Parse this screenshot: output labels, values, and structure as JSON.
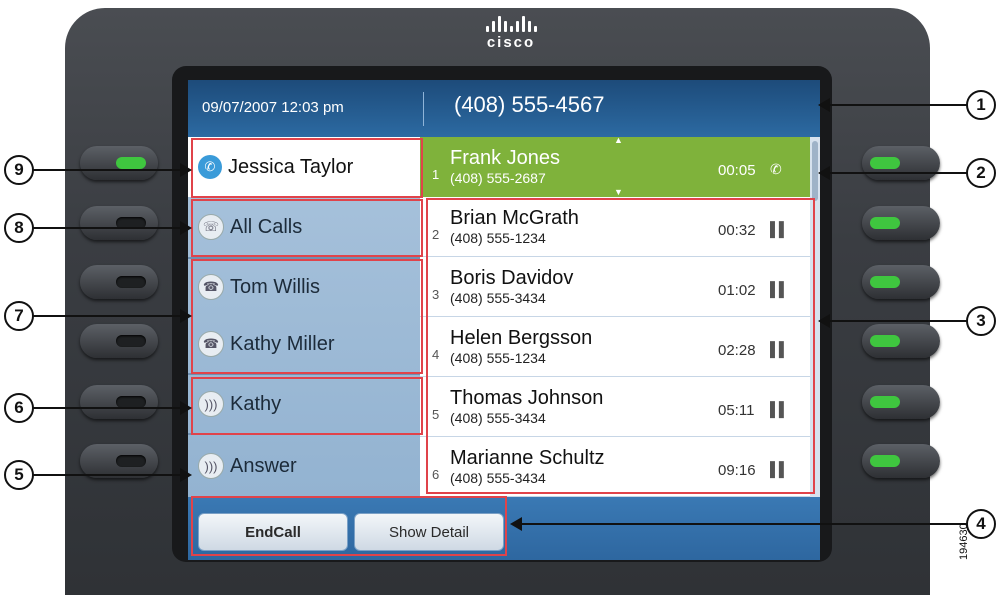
{
  "brand": {
    "logo_text": "cisco"
  },
  "header": {
    "datetime": "09/07/2007 12:03 pm",
    "phone_number": "(408) 555-4567"
  },
  "lines": [
    {
      "label": "Jessica Taylor",
      "icon": "phone-line-icon",
      "active": true
    },
    {
      "label": "All Calls",
      "icon": "all-calls-icon"
    },
    {
      "label": "Tom Willis",
      "icon": "handset-icon"
    },
    {
      "label": "Kathy Miller",
      "icon": "handset-icon"
    },
    {
      "label": "Kathy",
      "icon": "ringing-line-icon"
    },
    {
      "label": "Answer",
      "icon": "answer-icon"
    }
  ],
  "calls": [
    {
      "index": "1",
      "name": "Frank Jones",
      "number": "(408) 555-2687",
      "time": "00:05",
      "state": "active-call-icon"
    },
    {
      "index": "2",
      "name": "Brian McGrath",
      "number": "(408) 555-1234",
      "time": "00:32",
      "state": "hold-icon"
    },
    {
      "index": "3",
      "name": "Boris Davidov",
      "number": "(408) 555-3434",
      "time": "01:02",
      "state": "hold-icon"
    },
    {
      "index": "4",
      "name": "Helen Bergsson",
      "number": "(408) 555-1234",
      "time": "02:28",
      "state": "hold-icon"
    },
    {
      "index": "5",
      "name": "Thomas Johnson",
      "number": "(408) 555-3434",
      "time": "05:11",
      "state": "hold-icon"
    },
    {
      "index": "6",
      "name": "Marianne Schultz",
      "number": "(408) 555-3434",
      "time": "09:16",
      "state": "hold-icon"
    }
  ],
  "softkeys": {
    "end_call": "EndCall",
    "show_detail": "Show Detail"
  },
  "callouts": [
    "1",
    "2",
    "3",
    "4",
    "5",
    "6",
    "7",
    "8",
    "9"
  ],
  "figure_id": "194630",
  "colors": {
    "active_call": "#7fb23b",
    "led_on": "#3fc63f",
    "highlight_box": "#e0434a",
    "screen_blue": "#2f6fa6"
  }
}
